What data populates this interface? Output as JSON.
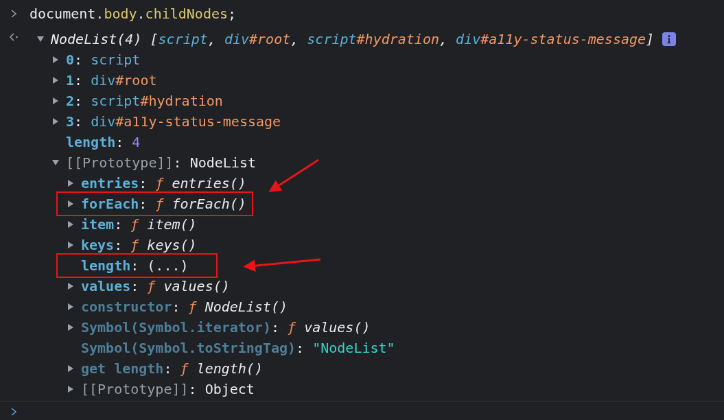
{
  "command": {
    "segments": [
      {
        "text": "document.",
        "kind": "plain"
      },
      {
        "text": "body",
        "kind": "prop"
      },
      {
        "text": ".",
        "kind": "plain"
      },
      {
        "text": "childNodes",
        "kind": "prop"
      },
      {
        "text": ";",
        "kind": "plain"
      }
    ]
  },
  "result": {
    "kind": "node",
    "expanded": true,
    "info_badge": true,
    "segments": [
      {
        "text": "NodeList(4) [",
        "kind": "summary"
      },
      {
        "text": "script",
        "kind": "tag-italic"
      },
      {
        "text": ", ",
        "kind": "summary"
      },
      {
        "text": "div",
        "kind": "tag-italic"
      },
      {
        "text": "#root",
        "kind": "id-italic"
      },
      {
        "text": ", ",
        "kind": "summary"
      },
      {
        "text": "script",
        "kind": "tag-italic"
      },
      {
        "text": "#hydration",
        "kind": "id-italic"
      },
      {
        "text": ", ",
        "kind": "summary"
      },
      {
        "text": "div",
        "kind": "tag-italic"
      },
      {
        "text": "#a11y-status-message",
        "kind": "id-italic"
      },
      {
        "text": "]",
        "kind": "summary"
      }
    ],
    "children": [
      {
        "kind": "node",
        "expanded": false,
        "segments": [
          {
            "text": "0",
            "kind": "key"
          },
          {
            "text": ": ",
            "kind": "plain"
          },
          {
            "text": "script",
            "kind": "tag"
          }
        ]
      },
      {
        "kind": "node",
        "expanded": false,
        "segments": [
          {
            "text": "1",
            "kind": "key"
          },
          {
            "text": ": ",
            "kind": "plain"
          },
          {
            "text": "div",
            "kind": "tag"
          },
          {
            "text": "#root",
            "kind": "id"
          }
        ]
      },
      {
        "kind": "node",
        "expanded": false,
        "segments": [
          {
            "text": "2",
            "kind": "key"
          },
          {
            "text": ": ",
            "kind": "plain"
          },
          {
            "text": "script",
            "kind": "tag"
          },
          {
            "text": "#hydration",
            "kind": "id"
          }
        ]
      },
      {
        "kind": "node",
        "expanded": false,
        "segments": [
          {
            "text": "3",
            "kind": "key"
          },
          {
            "text": ": ",
            "kind": "plain"
          },
          {
            "text": "div",
            "kind": "tag"
          },
          {
            "text": "#a11y-status-message",
            "kind": "id"
          }
        ]
      },
      {
        "kind": "leaf",
        "segments": [
          {
            "text": "length",
            "kind": "key"
          },
          {
            "text": ": ",
            "kind": "plain"
          },
          {
            "text": "4",
            "kind": "number"
          }
        ]
      },
      {
        "kind": "node",
        "expanded": true,
        "segments": [
          {
            "text": "[[Prototype]]",
            "kind": "proto"
          },
          {
            "text": ": NodeList",
            "kind": "plain"
          }
        ],
        "children": [
          {
            "kind": "node",
            "expanded": false,
            "segments": [
              {
                "text": "entries",
                "kind": "key"
              },
              {
                "text": ": ",
                "kind": "plain"
              },
              {
                "text": "ƒ ",
                "kind": "func"
              },
              {
                "text": "entries()",
                "kind": "italic"
              }
            ]
          },
          {
            "kind": "node",
            "expanded": false,
            "highlighted": true,
            "segments": [
              {
                "text": "forEach",
                "kind": "key"
              },
              {
                "text": ": ",
                "kind": "plain"
              },
              {
                "text": "ƒ ",
                "kind": "func"
              },
              {
                "text": "forEach()",
                "kind": "italic"
              }
            ]
          },
          {
            "kind": "node",
            "expanded": false,
            "segments": [
              {
                "text": "item",
                "kind": "key"
              },
              {
                "text": ": ",
                "kind": "plain"
              },
              {
                "text": "ƒ ",
                "kind": "func"
              },
              {
                "text": "item()",
                "kind": "italic"
              }
            ]
          },
          {
            "kind": "node",
            "expanded": false,
            "segments": [
              {
                "text": "keys",
                "kind": "key"
              },
              {
                "text": ": ",
                "kind": "plain"
              },
              {
                "text": "ƒ ",
                "kind": "func"
              },
              {
                "text": "keys()",
                "kind": "italic"
              }
            ]
          },
          {
            "kind": "leaf",
            "highlighted": true,
            "segments": [
              {
                "text": "length",
                "kind": "key"
              },
              {
                "text": ": (...)",
                "kind": "plain"
              }
            ]
          },
          {
            "kind": "node",
            "expanded": false,
            "segments": [
              {
                "text": "values",
                "kind": "key"
              },
              {
                "text": ": ",
                "kind": "plain"
              },
              {
                "text": "ƒ ",
                "kind": "func"
              },
              {
                "text": "values()",
                "kind": "italic"
              }
            ]
          },
          {
            "kind": "node",
            "expanded": false,
            "segments": [
              {
                "text": "constructor",
                "kind": "dimkey"
              },
              {
                "text": ": ",
                "kind": "plain"
              },
              {
                "text": "ƒ ",
                "kind": "func"
              },
              {
                "text": "NodeList()",
                "kind": "italic"
              }
            ]
          },
          {
            "kind": "node",
            "expanded": false,
            "segments": [
              {
                "text": "Symbol(Symbol.iterator)",
                "kind": "dimkey"
              },
              {
                "text": ": ",
                "kind": "plain"
              },
              {
                "text": "ƒ ",
                "kind": "func"
              },
              {
                "text": "values()",
                "kind": "italic"
              }
            ]
          },
          {
            "kind": "leaf",
            "segments": [
              {
                "text": "Symbol(Symbol.toStringTag)",
                "kind": "dimkey"
              },
              {
                "text": ": ",
                "kind": "plain"
              },
              {
                "text": "\"NodeList\"",
                "kind": "string"
              }
            ]
          },
          {
            "kind": "node",
            "expanded": false,
            "segments": [
              {
                "text": "get length",
                "kind": "dimkey"
              },
              {
                "text": ": ",
                "kind": "plain"
              },
              {
                "text": "ƒ ",
                "kind": "func"
              },
              {
                "text": "length()",
                "kind": "italic"
              }
            ]
          },
          {
            "kind": "node",
            "expanded": false,
            "segments": [
              {
                "text": "[[Prototype]]",
                "kind": "proto"
              },
              {
                "text": ": Object",
                "kind": "plain"
              }
            ]
          }
        ]
      }
    ]
  }
}
